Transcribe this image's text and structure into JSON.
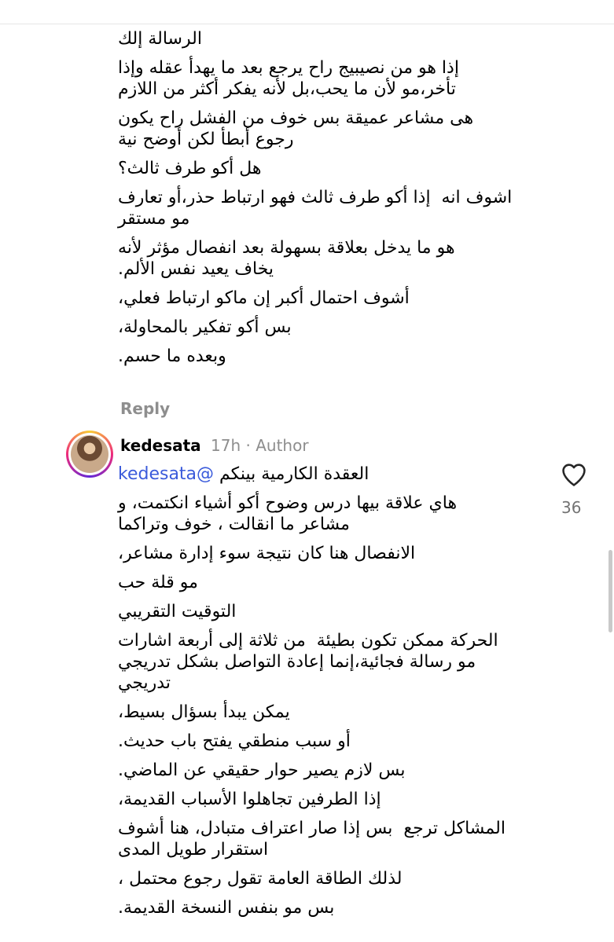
{
  "comment_first": {
    "paragraphs": [
      [
        "الرسالة إلك"
      ],
      [
        "إذا هو من نصيبيج راح يرجع بعد ما يهدأ عقله وإذا",
        "تأخر،مو لأن ما يحب،بل لأنه يفكر أكثر من اللازم"
      ],
      [
        "هى مشاعر عميقة بس خوف من الفشل راح يكون",
        "رجوع أبطأ لكن أوضح نية"
      ],
      [
        "هل أكو طرف ثالث؟"
      ],
      [
        "اشوف انه  إذا أكو طرف ثالث فهو ارتباط حذر،أو تعارف",
        "مو مستقر"
      ],
      [
        "هو ما يدخل بعلاقة بسهولة بعد انفصال مؤثر لأنه",
        "يخاف يعيد نفس الألم."
      ],
      [
        "أشوف احتمال أكبر إن ماكو ارتباط فعلي،"
      ],
      [
        "بس أكو تفكير بالمحاولة،"
      ],
      [
        "وبعده ما حسم."
      ]
    ],
    "reply_label": "Reply"
  },
  "comment_second": {
    "username": "kedesata",
    "time": "17h",
    "separator": "·",
    "author_badge": "Author",
    "likes": "36",
    "mention_prefix": "العقدة الكارمية بينكم ",
    "mention": "@kedesata",
    "paragraphs": [
      [
        "هاي علاقة بيها درس وضوح أكو أشياء انكتمت، و",
        "مشاعر ما انقالت ، خوف وتراكما"
      ],
      [
        "الانفصال هنا كان نتيجة سوء إدارة مشاعر،"
      ],
      [
        "مو قلة حب"
      ],
      [
        "التوقيت التقريبي"
      ],
      [
        "الحركة ممكن تكون بطيئة  من ثلاثة إلى أربعة اشارات",
        "مو رسالة فجائية،إنما إعادة التواصل بشكل تدريجي",
        "تدريجي"
      ],
      [
        "يمكن يبدأ بسؤال بسيط،"
      ],
      [
        "أو سبب منطقي يفتح باب حديث."
      ],
      [
        "بس لازم يصير حوار حقيقي عن الماضي."
      ],
      [
        "إذا الطرفين تجاهلوا الأسباب القديمة،"
      ],
      [
        "المشاكل ترجع  بس إذا صار اعتراف متبادل، هنا أشوف",
        "استقرار طويل المدى"
      ],
      [
        "لذلك الطاقة العامة تقول رجوع محتمل ،"
      ],
      [
        "بس مو بنفس النسخة القديمة."
      ]
    ],
    "icons": {
      "heart": "heart-outline-icon",
      "avatar": "profile-avatar"
    },
    "colors": {
      "mention": "#3b5bdb",
      "muted": "#8e8e8e"
    }
  }
}
